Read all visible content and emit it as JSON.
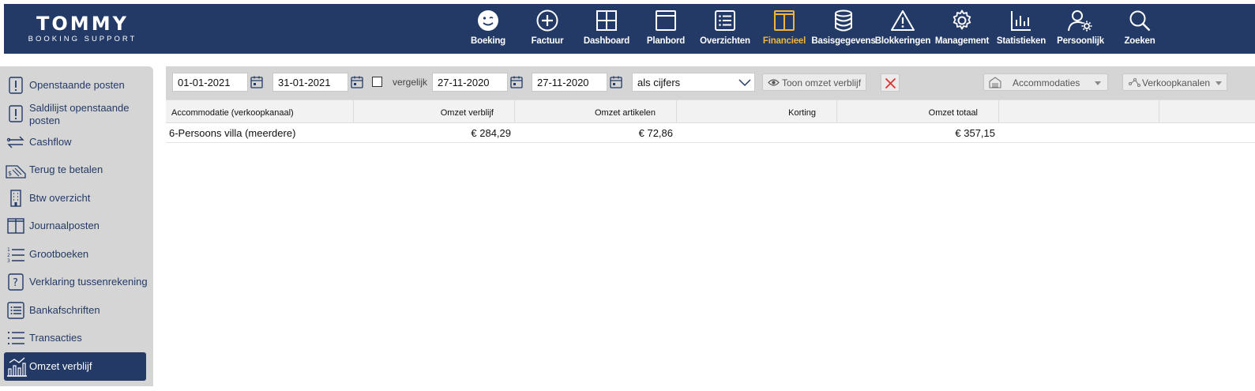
{
  "app": {
    "logo_main": "TOMMY",
    "logo_sub": "BOOKING SUPPORT"
  },
  "nav": [
    {
      "label": "Boeking",
      "icon": "smiley-icon",
      "active": false
    },
    {
      "label": "Factuur",
      "icon": "plus-circle-icon",
      "active": false
    },
    {
      "label": "Dashboard",
      "icon": "grid-icon",
      "active": false
    },
    {
      "label": "Planbord",
      "icon": "window-icon",
      "active": false
    },
    {
      "label": "Overzichten",
      "icon": "list-icon",
      "active": false
    },
    {
      "label": "Financieel",
      "icon": "columns-icon",
      "active": true
    },
    {
      "label": "Basisgegevens",
      "icon": "database-icon",
      "active": false
    },
    {
      "label": "Blokkeringen",
      "icon": "warning-icon",
      "active": false
    },
    {
      "label": "Management",
      "icon": "gear-icon",
      "active": false
    },
    {
      "label": "Statistieken",
      "icon": "bar-chart-icon",
      "active": false
    },
    {
      "label": "Persoonlijk",
      "icon": "user-gear-icon",
      "active": false
    },
    {
      "label": "Zoeken",
      "icon": "search-icon",
      "active": false
    }
  ],
  "sidebar": {
    "items": [
      {
        "label": "Openstaande posten",
        "icon": "exclamation-doc-icon"
      },
      {
        "label": "Saldilijst openstaande posten",
        "icon": "exclamation-doc-icon"
      },
      {
        "label": "Cashflow",
        "icon": "transfer-icon"
      },
      {
        "label": "Terug te betalen",
        "icon": "refund-icon"
      },
      {
        "label": "Btw overzicht",
        "icon": "building-icon"
      },
      {
        "label": "Journaalposten",
        "icon": "book-icon"
      },
      {
        "label": "Grootboeken",
        "icon": "numbered-list-icon"
      },
      {
        "label": "Verklaring tussenrekening",
        "icon": "question-icon"
      },
      {
        "label": "Bankafschriften",
        "icon": "list-box-icon"
      },
      {
        "label": "Transacties",
        "icon": "bullet-list-icon"
      },
      {
        "label": "Omzet verblijf",
        "icon": "chart-icon",
        "active": true
      }
    ]
  },
  "toolbar": {
    "date_from": "01-01-2021",
    "date_to": "31-01-2021",
    "compare_label": "vergelijk",
    "compare_checked": false,
    "compare_from": "27-11-2020",
    "compare_to": "27-11-2020",
    "display_mode": "als cijfers",
    "toon_label": "Toon omzet verblijf",
    "accommodaties_label": "Accommodaties",
    "verkoopkanalen_label": "Verkoopkanalen"
  },
  "table": {
    "columns": [
      "Accommodatie (verkoopkanaal)",
      "Omzet verblijf",
      "Omzet artikelen",
      "Korting",
      "Omzet totaal",
      "",
      ""
    ],
    "rows": [
      {
        "name": "6-Persoons villa (meerdere)",
        "omzet_verblijf": "€ 284,29",
        "omzet_artikelen": "€ 72,86",
        "korting": "",
        "omzet_totaal": "€ 357,15"
      }
    ]
  },
  "colors": {
    "header_bg": "#233a66",
    "active_accent": "#f0b63c",
    "sidebar_bg": "#d5d5d5",
    "clear_icon": "#e03030"
  }
}
